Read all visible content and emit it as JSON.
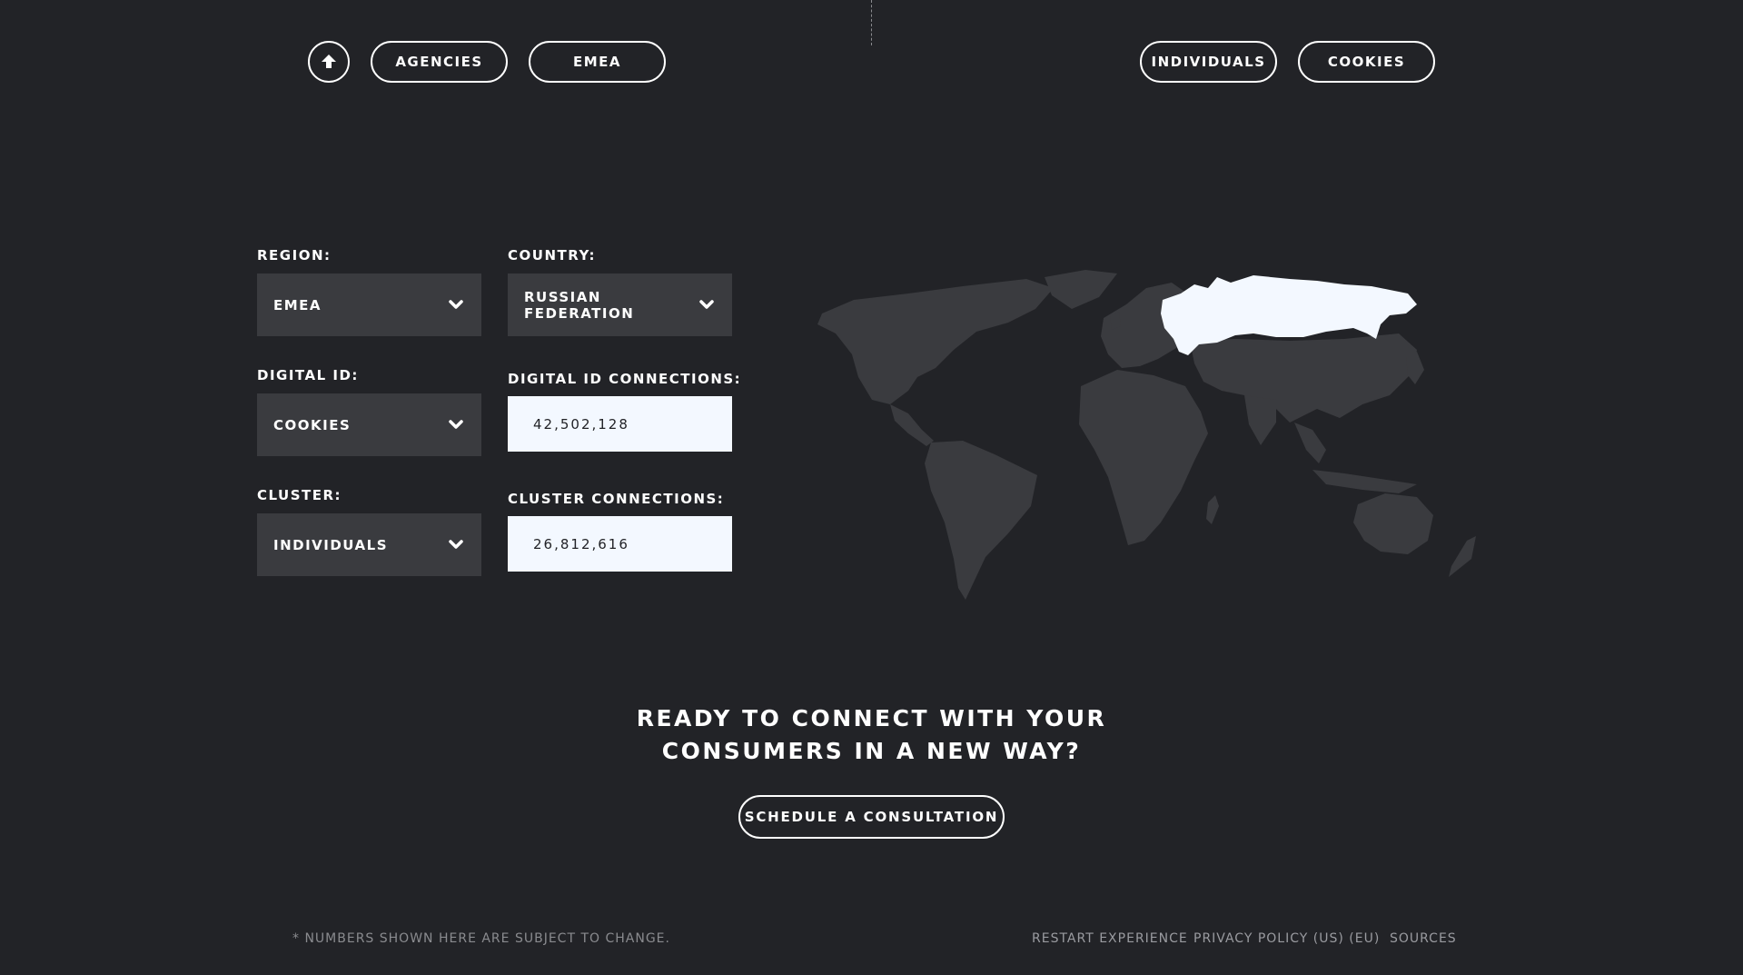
{
  "nav": {
    "home_icon": "home-arrow-up-icon",
    "left_pills": [
      "AGENCIES",
      "EMEA"
    ],
    "right_pills": [
      "INDIVIDUALS",
      "COOKIES"
    ]
  },
  "form": {
    "region": {
      "label": "REGION:",
      "value": "EMEA"
    },
    "country": {
      "label": "COUNTRY:",
      "value": "RUSSIAN FEDERATION"
    },
    "digital_id": {
      "label": "DIGITAL ID:",
      "value": "COOKIES"
    },
    "digital_id_connections": {
      "label": "DIGITAL ID CONNECTIONS:",
      "value": "42,502,128"
    },
    "cluster": {
      "label": "CLUSTER:",
      "value": "INDIVIDUALS"
    },
    "cluster_connections": {
      "label": "CLUSTER CONNECTIONS:",
      "value": "26,812,616"
    }
  },
  "map": {
    "highlighted_country": "Russian Federation",
    "land_color": "#3a3b3f",
    "highlight_color": "#f3f8ff"
  },
  "cta": {
    "title_line1": "READY TO CONNECT WITH YOUR",
    "title_line2": "CONSUMERS IN A NEW WAY?",
    "button": "SCHEDULE A CONSULTATION"
  },
  "footer": {
    "note": "* NUMBERS SHOWN HERE ARE SUBJECT TO CHANGE.",
    "links": [
      "RESTART EXPERIENCE",
      "PRIVACY POLICY (US) (EU)",
      "SOURCES"
    ]
  },
  "colors": {
    "background": "#222327",
    "panel": "#3a3b3f",
    "readout": "#f3f8ff",
    "text": "#ffffff",
    "muted": "#8a8b8f"
  }
}
